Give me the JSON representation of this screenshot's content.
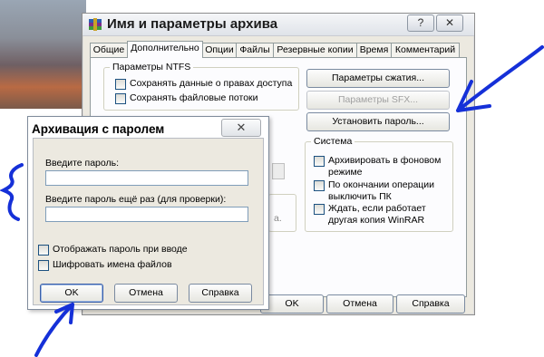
{
  "archive_dialog": {
    "title": "Имя и параметры архива",
    "help_button": "?",
    "close_button": "✕",
    "tabs": [
      {
        "label": "Общие"
      },
      {
        "label": "Дополнительно"
      },
      {
        "label": "Опции"
      },
      {
        "label": "Файлы"
      },
      {
        "label": "Резервные копии"
      },
      {
        "label": "Время"
      },
      {
        "label": "Комментарий"
      }
    ],
    "active_tab": "Дополнительно",
    "ntfs_group": {
      "legend": "Параметры NTFS",
      "options": [
        {
          "label": "Сохранять данные о правах доступа",
          "checked": false
        },
        {
          "label": "Сохранять файловые потоки",
          "checked": false
        }
      ]
    },
    "compression_params_button": "Параметры сжатия...",
    "sfx_params_button": "Параметры SFX...",
    "set_password_button": "Установить пароль...",
    "system_group": {
      "legend": "Система",
      "options": [
        {
          "label": "Архивировать в фоновом режиме",
          "checked": false
        },
        {
          "label": "По окончании операции выключить ПК",
          "checked": false
        },
        {
          "label": "Ждать, если работает другая копия WinRAR",
          "checked": false
        }
      ]
    },
    "partial_text": "а.",
    "ok_button": "OK",
    "cancel_button": "Отмена",
    "help_btn": "Справка"
  },
  "password_dialog": {
    "title": "Архивация с паролем",
    "close_button": "✕",
    "enter_password_label": "Введите пароль:",
    "enter_password_value": "",
    "reenter_password_label": "Введите пароль ещё раз (для проверки):",
    "reenter_password_value": "",
    "show_password": {
      "label": "Отображать пароль при вводе",
      "checked": false
    },
    "encrypt_names": {
      "label": "Шифровать имена файлов",
      "checked": false
    },
    "ok_button": "OK",
    "cancel_button": "Отмена",
    "help_button": "Справка"
  },
  "annotation_color": "#1530d8"
}
